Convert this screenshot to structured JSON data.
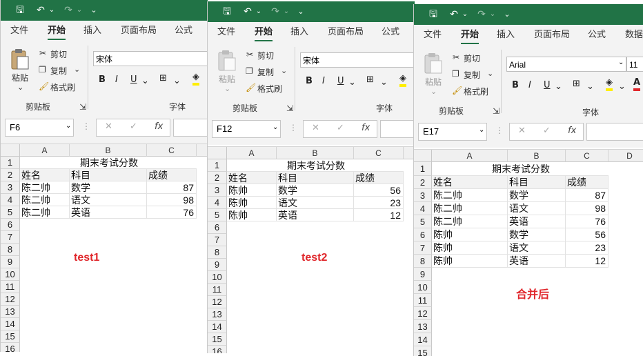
{
  "quick_access": {
    "save": "🖫",
    "undo": "↶",
    "redo": "↷",
    "more": "⌄"
  },
  "ribbon": {
    "tabs": [
      "文件",
      "开始",
      "插入",
      "页面布局",
      "公式",
      "数据"
    ],
    "clipboard": {
      "paste": "粘贴",
      "cut": "剪切",
      "copy": "复制",
      "painter": "格式刷",
      "group": "剪贴板"
    },
    "font_group": "字体",
    "format_buttons": {
      "bold": "B",
      "italic": "I",
      "underline": "U"
    }
  },
  "formula_bar": {
    "cancel": "✕",
    "enter": "✓",
    "fx": "fx"
  },
  "windows": [
    {
      "font_name": "宋体",
      "name_box": "F6",
      "columns": [
        "A",
        "B",
        "C"
      ],
      "rows": [
        "1",
        "2",
        "3",
        "4",
        "5",
        "6",
        "7",
        "8",
        "9",
        "10",
        "11",
        "12",
        "13",
        "14",
        "15",
        "16"
      ],
      "sheet_title": "期末考试分数",
      "headers": [
        "姓名",
        "科目",
        "成绩"
      ],
      "data": [
        [
          "陈二帅",
          "数学",
          "87"
        ],
        [
          "陈二帅",
          "语文",
          "98"
        ],
        [
          "陈二帅",
          "英语",
          "76"
        ]
      ],
      "note": "test1"
    },
    {
      "font_name": "宋体",
      "name_box": "F12",
      "columns": [
        "A",
        "B",
        "C"
      ],
      "rows": [
        "1",
        "2",
        "3",
        "4",
        "5",
        "6",
        "7",
        "8",
        "9",
        "10",
        "11",
        "12",
        "13",
        "14",
        "15",
        "16"
      ],
      "sheet_title": "期末考试分数",
      "headers": [
        "姓名",
        "科目",
        "成绩"
      ],
      "data": [
        [
          "陈帅",
          "数学",
          "56"
        ],
        [
          "陈帅",
          "语文",
          "23"
        ],
        [
          "陈帅",
          "英语",
          "12"
        ]
      ],
      "note": "test2"
    },
    {
      "font_name": "Arial",
      "font_size": "11",
      "name_box": "E17",
      "columns": [
        "A",
        "B",
        "C",
        "D"
      ],
      "rows": [
        "1",
        "2",
        "3",
        "4",
        "5",
        "6",
        "7",
        "8",
        "9",
        "10",
        "11",
        "12",
        "13",
        "14",
        "15"
      ],
      "sheet_title": "期末考试分数",
      "headers": [
        "姓名",
        "科目",
        "成绩"
      ],
      "data": [
        [
          "陈二帅",
          "数学",
          "87"
        ],
        [
          "陈二帅",
          "语文",
          "98"
        ],
        [
          "陈二帅",
          "英语",
          "76"
        ],
        [
          "陈帅",
          "数学",
          "56"
        ],
        [
          "陈帅",
          "语文",
          "23"
        ],
        [
          "陈帅",
          "英语",
          "12"
        ]
      ],
      "note": "合并后"
    }
  ],
  "colors": {
    "title_bar": "#217346",
    "note_red": "#e0262b"
  }
}
